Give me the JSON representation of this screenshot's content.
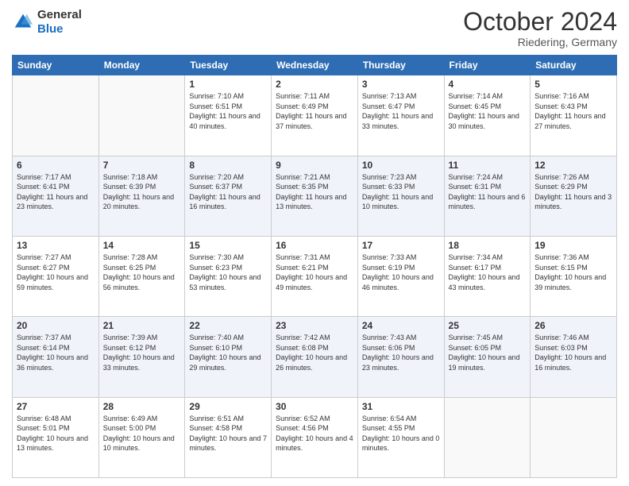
{
  "header": {
    "logo_general": "General",
    "logo_blue": "Blue",
    "month_title": "October 2024",
    "location": "Riedering, Germany"
  },
  "weekdays": [
    "Sunday",
    "Monday",
    "Tuesday",
    "Wednesday",
    "Thursday",
    "Friday",
    "Saturday"
  ],
  "weeks": [
    [
      {
        "day": "",
        "sunrise": "",
        "sunset": "",
        "daylight": ""
      },
      {
        "day": "",
        "sunrise": "",
        "sunset": "",
        "daylight": ""
      },
      {
        "day": "1",
        "sunrise": "Sunrise: 7:10 AM",
        "sunset": "Sunset: 6:51 PM",
        "daylight": "Daylight: 11 hours and 40 minutes."
      },
      {
        "day": "2",
        "sunrise": "Sunrise: 7:11 AM",
        "sunset": "Sunset: 6:49 PM",
        "daylight": "Daylight: 11 hours and 37 minutes."
      },
      {
        "day": "3",
        "sunrise": "Sunrise: 7:13 AM",
        "sunset": "Sunset: 6:47 PM",
        "daylight": "Daylight: 11 hours and 33 minutes."
      },
      {
        "day": "4",
        "sunrise": "Sunrise: 7:14 AM",
        "sunset": "Sunset: 6:45 PM",
        "daylight": "Daylight: 11 hours and 30 minutes."
      },
      {
        "day": "5",
        "sunrise": "Sunrise: 7:16 AM",
        "sunset": "Sunset: 6:43 PM",
        "daylight": "Daylight: 11 hours and 27 minutes."
      }
    ],
    [
      {
        "day": "6",
        "sunrise": "Sunrise: 7:17 AM",
        "sunset": "Sunset: 6:41 PM",
        "daylight": "Daylight: 11 hours and 23 minutes."
      },
      {
        "day": "7",
        "sunrise": "Sunrise: 7:18 AM",
        "sunset": "Sunset: 6:39 PM",
        "daylight": "Daylight: 11 hours and 20 minutes."
      },
      {
        "day": "8",
        "sunrise": "Sunrise: 7:20 AM",
        "sunset": "Sunset: 6:37 PM",
        "daylight": "Daylight: 11 hours and 16 minutes."
      },
      {
        "day": "9",
        "sunrise": "Sunrise: 7:21 AM",
        "sunset": "Sunset: 6:35 PM",
        "daylight": "Daylight: 11 hours and 13 minutes."
      },
      {
        "day": "10",
        "sunrise": "Sunrise: 7:23 AM",
        "sunset": "Sunset: 6:33 PM",
        "daylight": "Daylight: 11 hours and 10 minutes."
      },
      {
        "day": "11",
        "sunrise": "Sunrise: 7:24 AM",
        "sunset": "Sunset: 6:31 PM",
        "daylight": "Daylight: 11 hours and 6 minutes."
      },
      {
        "day": "12",
        "sunrise": "Sunrise: 7:26 AM",
        "sunset": "Sunset: 6:29 PM",
        "daylight": "Daylight: 11 hours and 3 minutes."
      }
    ],
    [
      {
        "day": "13",
        "sunrise": "Sunrise: 7:27 AM",
        "sunset": "Sunset: 6:27 PM",
        "daylight": "Daylight: 10 hours and 59 minutes."
      },
      {
        "day": "14",
        "sunrise": "Sunrise: 7:28 AM",
        "sunset": "Sunset: 6:25 PM",
        "daylight": "Daylight: 10 hours and 56 minutes."
      },
      {
        "day": "15",
        "sunrise": "Sunrise: 7:30 AM",
        "sunset": "Sunset: 6:23 PM",
        "daylight": "Daylight: 10 hours and 53 minutes."
      },
      {
        "day": "16",
        "sunrise": "Sunrise: 7:31 AM",
        "sunset": "Sunset: 6:21 PM",
        "daylight": "Daylight: 10 hours and 49 minutes."
      },
      {
        "day": "17",
        "sunrise": "Sunrise: 7:33 AM",
        "sunset": "Sunset: 6:19 PM",
        "daylight": "Daylight: 10 hours and 46 minutes."
      },
      {
        "day": "18",
        "sunrise": "Sunrise: 7:34 AM",
        "sunset": "Sunset: 6:17 PM",
        "daylight": "Daylight: 10 hours and 43 minutes."
      },
      {
        "day": "19",
        "sunrise": "Sunrise: 7:36 AM",
        "sunset": "Sunset: 6:15 PM",
        "daylight": "Daylight: 10 hours and 39 minutes."
      }
    ],
    [
      {
        "day": "20",
        "sunrise": "Sunrise: 7:37 AM",
        "sunset": "Sunset: 6:14 PM",
        "daylight": "Daylight: 10 hours and 36 minutes."
      },
      {
        "day": "21",
        "sunrise": "Sunrise: 7:39 AM",
        "sunset": "Sunset: 6:12 PM",
        "daylight": "Daylight: 10 hours and 33 minutes."
      },
      {
        "day": "22",
        "sunrise": "Sunrise: 7:40 AM",
        "sunset": "Sunset: 6:10 PM",
        "daylight": "Daylight: 10 hours and 29 minutes."
      },
      {
        "day": "23",
        "sunrise": "Sunrise: 7:42 AM",
        "sunset": "Sunset: 6:08 PM",
        "daylight": "Daylight: 10 hours and 26 minutes."
      },
      {
        "day": "24",
        "sunrise": "Sunrise: 7:43 AM",
        "sunset": "Sunset: 6:06 PM",
        "daylight": "Daylight: 10 hours and 23 minutes."
      },
      {
        "day": "25",
        "sunrise": "Sunrise: 7:45 AM",
        "sunset": "Sunset: 6:05 PM",
        "daylight": "Daylight: 10 hours and 19 minutes."
      },
      {
        "day": "26",
        "sunrise": "Sunrise: 7:46 AM",
        "sunset": "Sunset: 6:03 PM",
        "daylight": "Daylight: 10 hours and 16 minutes."
      }
    ],
    [
      {
        "day": "27",
        "sunrise": "Sunrise: 6:48 AM",
        "sunset": "Sunset: 5:01 PM",
        "daylight": "Daylight: 10 hours and 13 minutes."
      },
      {
        "day": "28",
        "sunrise": "Sunrise: 6:49 AM",
        "sunset": "Sunset: 5:00 PM",
        "daylight": "Daylight: 10 hours and 10 minutes."
      },
      {
        "day": "29",
        "sunrise": "Sunrise: 6:51 AM",
        "sunset": "Sunset: 4:58 PM",
        "daylight": "Daylight: 10 hours and 7 minutes."
      },
      {
        "day": "30",
        "sunrise": "Sunrise: 6:52 AM",
        "sunset": "Sunset: 4:56 PM",
        "daylight": "Daylight: 10 hours and 4 minutes."
      },
      {
        "day": "31",
        "sunrise": "Sunrise: 6:54 AM",
        "sunset": "Sunset: 4:55 PM",
        "daylight": "Daylight: 10 hours and 0 minutes."
      },
      {
        "day": "",
        "sunrise": "",
        "sunset": "",
        "daylight": ""
      },
      {
        "day": "",
        "sunrise": "",
        "sunset": "",
        "daylight": ""
      }
    ]
  ]
}
